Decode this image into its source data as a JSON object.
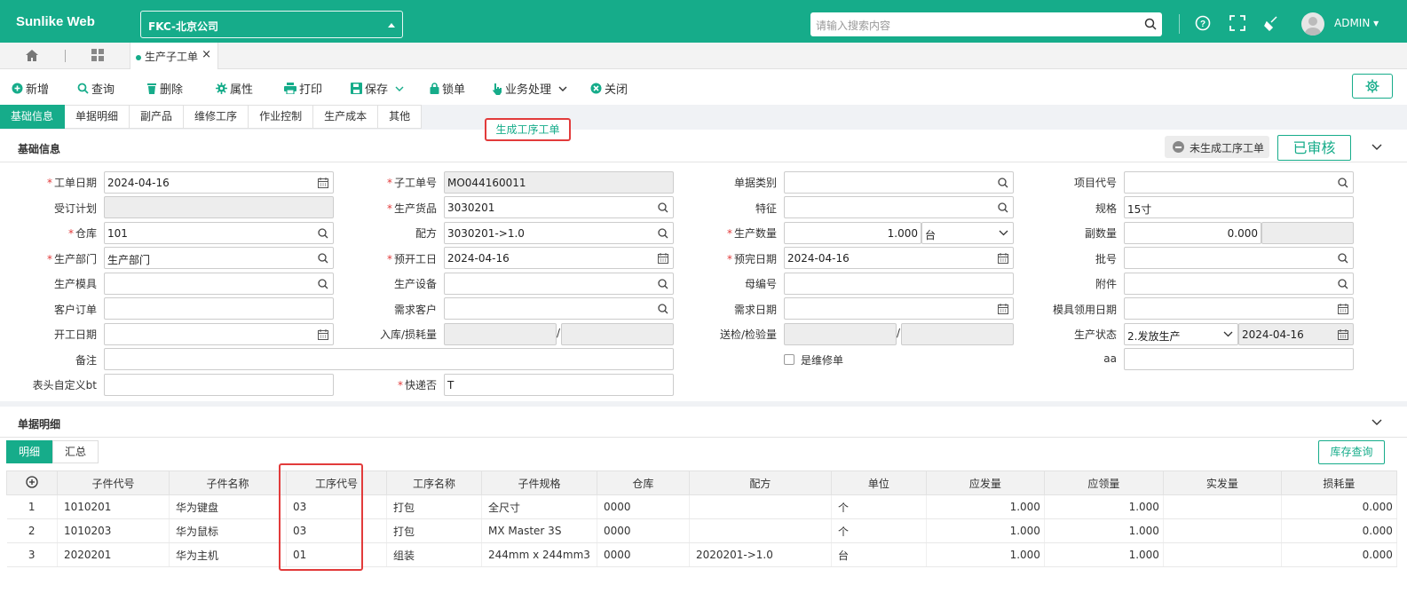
{
  "app": {
    "brand": "Sunlike Web",
    "company": "FKC-北京公司",
    "search_placeholder": "请输入搜索内容",
    "user": "ADMIN"
  },
  "tabs": {
    "doc_tab": "生产子工单",
    "close": "×"
  },
  "toolbar": {
    "new": "新增",
    "query": "查询",
    "delete": "删除",
    "props": "属性",
    "print": "打印",
    "save": "保存",
    "lock": "锁单",
    "business": "业务处理",
    "close": "关闭"
  },
  "popup": {
    "generate": "生成工序工单"
  },
  "subtabs": [
    "基础信息",
    "单据明细",
    "副产品",
    "维修工序",
    "作业控制",
    "生产成本",
    "其他"
  ],
  "basic": {
    "title": "基础信息",
    "status_pending": "未生成工序工单",
    "status_audited": "已审核",
    "labels": {
      "work_date": "工单日期",
      "sub_no": "子工单号",
      "doc_type": "单据类别",
      "project": "项目代号",
      "order_plan": "受订计划",
      "product": "生产货品",
      "feature": "特征",
      "spec": "规格",
      "warehouse": "仓库",
      "recipe": "配方",
      "qty": "生产数量",
      "sub_qty": "副数量",
      "dept": "生产部门",
      "plan_start": "预开工日",
      "plan_end": "预完日期",
      "batch": "批号",
      "mold": "生产模具",
      "equipment": "生产设备",
      "parent_no": "母编号",
      "attach": "附件",
      "cust_order": "客户订单",
      "req_cust": "需求客户",
      "req_date": "需求日期",
      "mold_date": "模具领用日期",
      "start_date": "开工日期",
      "in_loss": "入库/损耗量",
      "insp_qty": "送检/检验量",
      "prod_status": "生产状态",
      "remark": "备注",
      "is_repair": "是维修单",
      "aa": "aa",
      "custom_bt": "表头自定义bt",
      "express": "快递否"
    },
    "values": {
      "work_date": "2024-04-16",
      "sub_no": "MO044160011",
      "product": "3030201",
      "spec": "15寸",
      "warehouse": "101",
      "recipe": "3030201->1.0",
      "qty": "1.000",
      "unit": "台",
      "sub_qty": "0.000",
      "dept": "生产部门",
      "plan_start": "2024-04-16",
      "plan_end": "2024-04-16",
      "prod_status": "2.发放生产",
      "status_date": "2024-04-16",
      "express": "T",
      "slash": "/"
    }
  },
  "detail": {
    "title": "单据明细",
    "tabs": [
      "明细",
      "汇总"
    ],
    "stock_button": "库存查询",
    "columns": [
      "子件代号",
      "子件名称",
      "工序代号",
      "工序名称",
      "子件规格",
      "仓库",
      "配方",
      "单位",
      "应发量",
      "应领量",
      "实发量",
      "损耗量"
    ],
    "rows": [
      {
        "no": "1",
        "code": "1010201",
        "name": "华为键盘",
        "proc": "03",
        "proc_name": "打包",
        "spec": "全尺寸",
        "wh": "0000",
        "recipe": "",
        "unit": "个",
        "issue": "1.000",
        "need": "1.000",
        "actual": "",
        "loss": "0.000"
      },
      {
        "no": "2",
        "code": "1010203",
        "name": "华为鼠标",
        "proc": "03",
        "proc_name": "打包",
        "spec": "MX Master 3S",
        "wh": "0000",
        "recipe": "",
        "unit": "个",
        "issue": "1.000",
        "need": "1.000",
        "actual": "",
        "loss": "0.000"
      },
      {
        "no": "3",
        "code": "2020201",
        "name": "华为主机",
        "proc": "01",
        "proc_name": "组装",
        "spec": "244mm x 244mm3",
        "wh": "0000",
        "recipe": "2020201->1.0",
        "unit": "台",
        "issue": "1.000",
        "need": "1.000",
        "actual": "",
        "loss": "0.000"
      }
    ]
  },
  "colors": {
    "accent": "#16ac8a",
    "highlight": "#e23b3b"
  }
}
